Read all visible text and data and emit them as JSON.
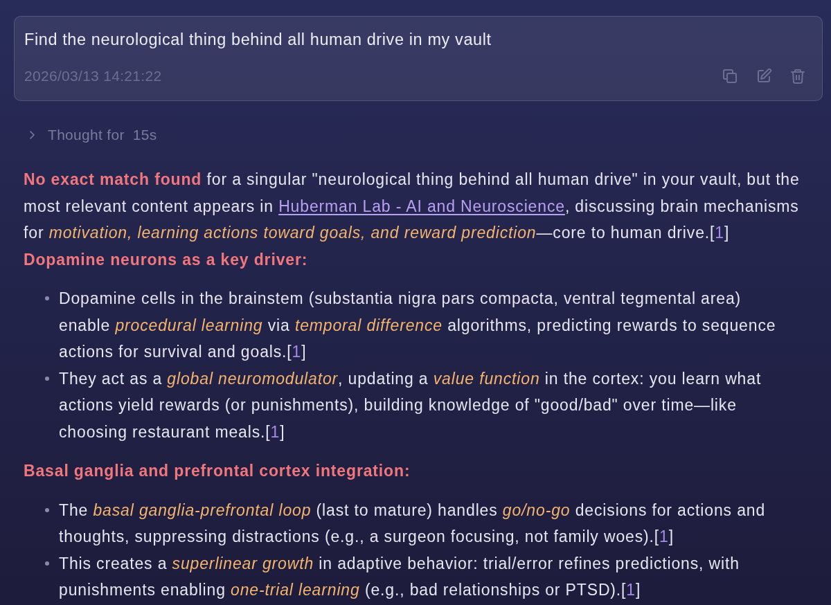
{
  "user_message": {
    "text": "Find the neurological thing behind all human drive in my vault",
    "timestamp": "2026/03/13 14:21:22",
    "actions": [
      {
        "kind": "copy"
      },
      {
        "kind": "edit"
      },
      {
        "kind": "delete"
      }
    ]
  },
  "thought": {
    "label": "Thought for",
    "duration": "15s",
    "expanded": false
  },
  "answer": [
    {
      "kind": "paragraph",
      "parts": [
        {
          "kind": "text",
          "text": "**No exact match found** for a singular \"neurological thing behind all human drive\" in your vault, but the most relevant content appears in "
        },
        {
          "kind": "link",
          "text": "Huberman Lab - AI and Neuroscience"
        },
        {
          "kind": "text",
          "text": ", discussing brain mechanisms for *motivation, learning actions toward goals, and reward prediction*—core to human drive.["
        },
        {
          "kind": "citation",
          "text": "1"
        },
        {
          "kind": "text",
          "text": "]"
        }
      ]
    },
    {
      "kind": "heading",
      "text": "Dopamine neurons as a key driver:"
    },
    {
      "kind": "list",
      "items": [
        {
          "parts": [
            {
              "kind": "text",
              "text": "Dopamine cells in the brainstem (substantia nigra pars compacta, ventral tegmental area) enable *procedural learning* via *temporal difference* algorithms, predicting rewards to sequence actions for survival and goals.["
            },
            {
              "kind": "citation",
              "text": "1"
            },
            {
              "kind": "text",
              "text": "]"
            }
          ]
        },
        {
          "parts": [
            {
              "kind": "text",
              "text": "They act as a *global neuromodulator*, updating a *value function* in the cortex: you learn what actions yield rewards (or punishments), building knowledge of \"good/bad\" over time—like choosing restaurant meals.["
            },
            {
              "kind": "citation",
              "text": "1"
            },
            {
              "kind": "text",
              "text": "]"
            }
          ]
        }
      ]
    },
    {
      "kind": "heading",
      "text": "Basal ganglia and prefrontal cortex integration:"
    },
    {
      "kind": "list",
      "items": [
        {
          "parts": [
            {
              "kind": "text",
              "text": "The *basal ganglia-prefrontal loop* (last to mature) handles *go/no-go* decisions for actions and thoughts, suppressing distractions (e.g., a surgeon focusing, not family woes).["
            },
            {
              "kind": "citation",
              "text": "1"
            },
            {
              "kind": "text",
              "text": "]"
            }
          ]
        },
        {
          "parts": [
            {
              "kind": "text",
              "text": "This creates a *superlinear growth* in adaptive behavior: trial/error refines predictions, with punishments enabling *one-trial learning* (e.g., bad relationships or PTSD).["
            },
            {
              "kind": "citation",
              "text": "1"
            },
            {
              "kind": "text",
              "text": "]"
            }
          ]
        }
      ]
    }
  ]
}
